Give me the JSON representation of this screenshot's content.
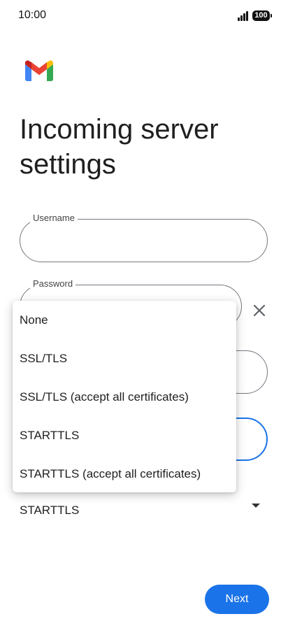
{
  "status_bar": {
    "time": "10:00",
    "battery": "100"
  },
  "header": {
    "logo_icon": "gmail-logo",
    "title": "Incoming server settings"
  },
  "form": {
    "username": {
      "label": "Username",
      "value": ""
    },
    "password": {
      "label": "Password",
      "value": ""
    },
    "security_type": {
      "selected": "STARTTLS"
    }
  },
  "dropdown": {
    "options": [
      "None",
      "SSL/TLS",
      "SSL/TLS (accept all certificates)",
      "STARTTLS",
      "STARTTLS (accept all certificates)"
    ]
  },
  "actions": {
    "next_label": "Next"
  },
  "colors": {
    "accent": "#1a73e8"
  }
}
